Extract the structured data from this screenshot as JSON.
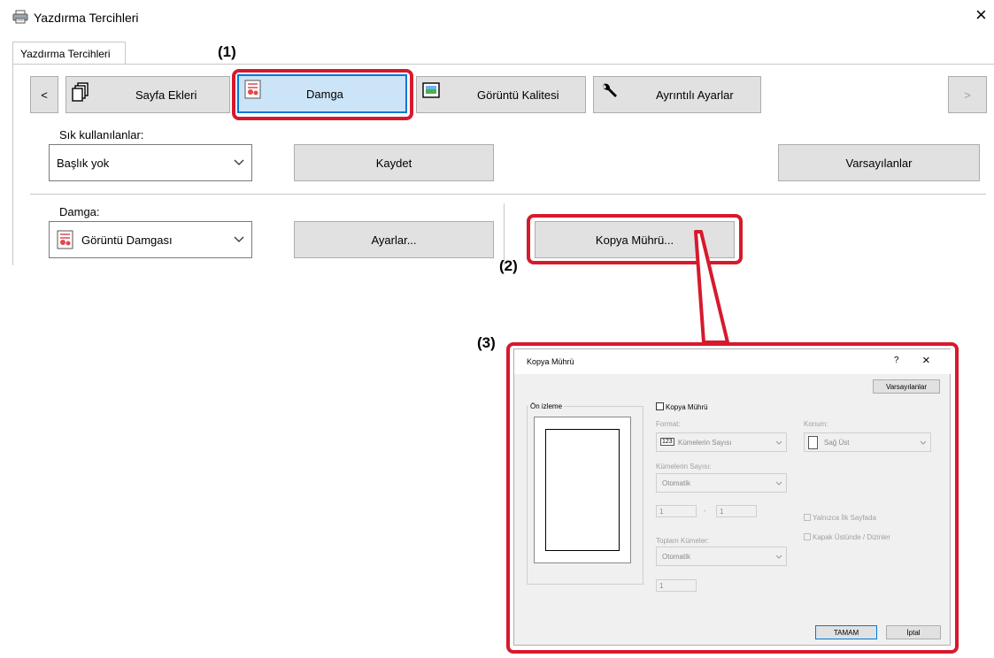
{
  "window": {
    "title": "Yazdırma Tercihleri",
    "close_glyph": "×",
    "tab_label": "Yazdırma Tercihleri"
  },
  "toolbar": {
    "prev_glyph": "<",
    "next_glyph": ">",
    "tabs": [
      {
        "label": "Sayfa Ekleri",
        "icon": "pages-icon"
      },
      {
        "label": "Damga",
        "icon": "stamp-icon"
      },
      {
        "label": "Görüntü Kalitesi",
        "icon": "image-icon"
      },
      {
        "label": "Ayrıntılı Ayarlar",
        "icon": "wrench-icon"
      }
    ]
  },
  "favorites": {
    "label": "Sık kullanılanlar:",
    "value": "Başlık yok",
    "save_label": "Kaydet",
    "defaults_label": "Varsayılanlar"
  },
  "stamp": {
    "label": "Damga:",
    "value": "Görüntü Damgası",
    "settings_label": "Ayarlar...",
    "copy_seal_label": "Kopya Mührü..."
  },
  "callouts": {
    "c1": "(1)",
    "c2": "(2)",
    "c3": "(3)"
  },
  "dialog": {
    "title": "Kopya Mührü",
    "help_glyph": "?",
    "close_glyph": "×",
    "defaults_label": "Varsayılanlar",
    "preview_label": "Ön izleme",
    "copy_seal_checkbox": "Kopya Mührü",
    "format_label": "Format:",
    "format_value": "Kümelerin Sayısı",
    "format_badge": "123",
    "position_label": "Konum:",
    "position_value": "Sağ Üst",
    "sets_label": "Kümelerin Sayısı:",
    "sets_value": "Otomatik",
    "range_from": "1",
    "range_sep": "-",
    "range_to": "1",
    "first_page_only": "Yalnızca İlk Sayfada",
    "cover_dividers": "Kapak Üstünde / Dizinler",
    "total_sets_label": "Toplam Kümeler:",
    "total_sets_value": "Otomatik",
    "total_value": "1",
    "ok_label": "TAMAM",
    "cancel_label": "İptal"
  },
  "colors": {
    "highlight_red": "#d7192d",
    "tab_active": "#cce4f7",
    "button_face": "#e1e1e1"
  }
}
